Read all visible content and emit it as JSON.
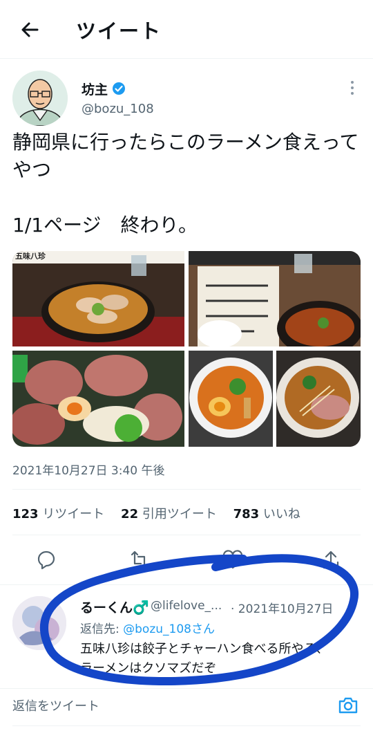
{
  "header": {
    "title": "ツイート"
  },
  "tweet": {
    "display_name": "坊主",
    "handle": "@bozu_108",
    "text": "静岡県に行ったらこのラーメン食えって\nやつ\n\n1/1ページ　終わり。",
    "media_caption": "五味八珍",
    "timestamp": "2021年10月27日 3:40 午後",
    "stats": {
      "retweets": "123",
      "retweets_label": "リツイート",
      "quotes": "22",
      "quotes_label": "引用ツイート",
      "likes": "783",
      "likes_label": "いいね"
    }
  },
  "reply": {
    "display_name": "るーくん♂️",
    "handle": "@lifelove_...",
    "date": "· 2021年10月27日",
    "reply_to_label": "返信先: ",
    "reply_to_handle": "@bozu_108さん",
    "text": "五味八珍は餃子とチャーハン食べる所やろ、\nラーメンはクソマズだぞ"
  },
  "composer": {
    "placeholder": "返信をツイート"
  },
  "colors": {
    "accent": "#1d9bf0",
    "annotation": "#1446c8"
  }
}
